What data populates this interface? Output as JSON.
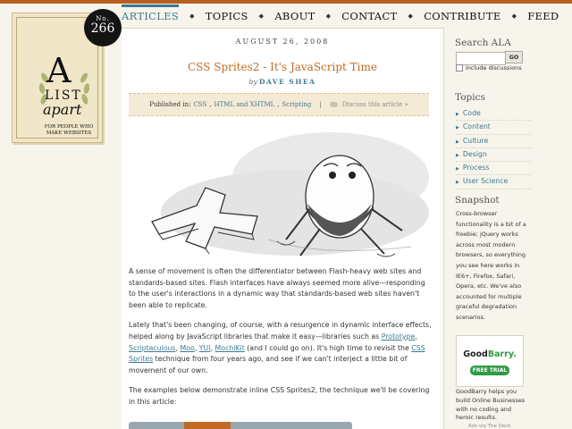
{
  "nav": {
    "items": [
      "ARTICLES",
      "TOPICS",
      "ABOUT",
      "CONTACT",
      "CONTRIBUTE",
      "FEED"
    ],
    "active": "ARTICLES",
    "separator": "◆"
  },
  "logo": {
    "issue_label": "No.",
    "issue_number": "266",
    "letter": "A",
    "word1": "LIST",
    "word2": "apart",
    "tagline": "FOR PEOPLE WHO MAKE WEBSITES"
  },
  "article": {
    "date": "AUGUST 26, 2008",
    "title": "CSS Sprites2 - It's JavaScript Time",
    "by": "by",
    "author": "DAVE SHEA",
    "published_in_label": "Published in:",
    "categories": [
      "CSS",
      "HTML and XHTML",
      "Scripting"
    ],
    "divider": "|",
    "discuss": "Discuss this article »",
    "p1": "A sense of movement is often the differentiator between Flash-heavy web sites and standards-based sites. Flash interfaces have always seemed more alive—responding to the user's interactions in a dynamic way that standards-based web sites haven't been able to replicate.",
    "p2": {
      "t1": "Lately that's been changing, of course, with a resurgence in dynamic interface effects, helped along by JavaScript libraries that make it easy—libraries such as ",
      "l1": "Prototype",
      "t2": ", ",
      "l2": "Scriptaculous",
      "t3": ", ",
      "l3": "Moo",
      "t4": ", ",
      "l4": "YUI",
      "t5": ", ",
      "l5": "MochiKit",
      "t6": " (and I could go on). It's high time to revisit the ",
      "l6": "CSS Sprites",
      "t7": " technique from four years ago, and see if we can't interject a little bit of movement of our own."
    },
    "p3": "The examples below demonstrate inline CSS Sprites2, the technique we'll be covering in this article:"
  },
  "sidebar": {
    "search_heading": "Search ALA",
    "search_value": "",
    "go_label": "GO",
    "include_label": "include discussions",
    "topics_heading": "Topics",
    "topics": [
      "Code",
      "Content",
      "Culture",
      "Design",
      "Process",
      "User Science"
    ],
    "snapshot_heading": "Snapshot",
    "snapshot_text": "Cross-browser functionality is a bit of a freebie; jQuery works across most modern browsers, so everything you see here works in IE6+, Firefox, Safari, Opera, etc. We've also accounted for multiple graceful degradation scenarios.",
    "ad": {
      "brand_good": "Good",
      "brand_barry": "Barry.",
      "trial": "FREE TRIAL",
      "text": "GoodBarry helps you build Online Businesses with no coding and heroic results.",
      "via": "Ads via The Deck"
    }
  },
  "colors": {
    "accent_orange": "#c06a26",
    "link_blue": "#3d7a92",
    "page_bg": "#f7f4ec",
    "ad_green": "#2f9a45"
  }
}
